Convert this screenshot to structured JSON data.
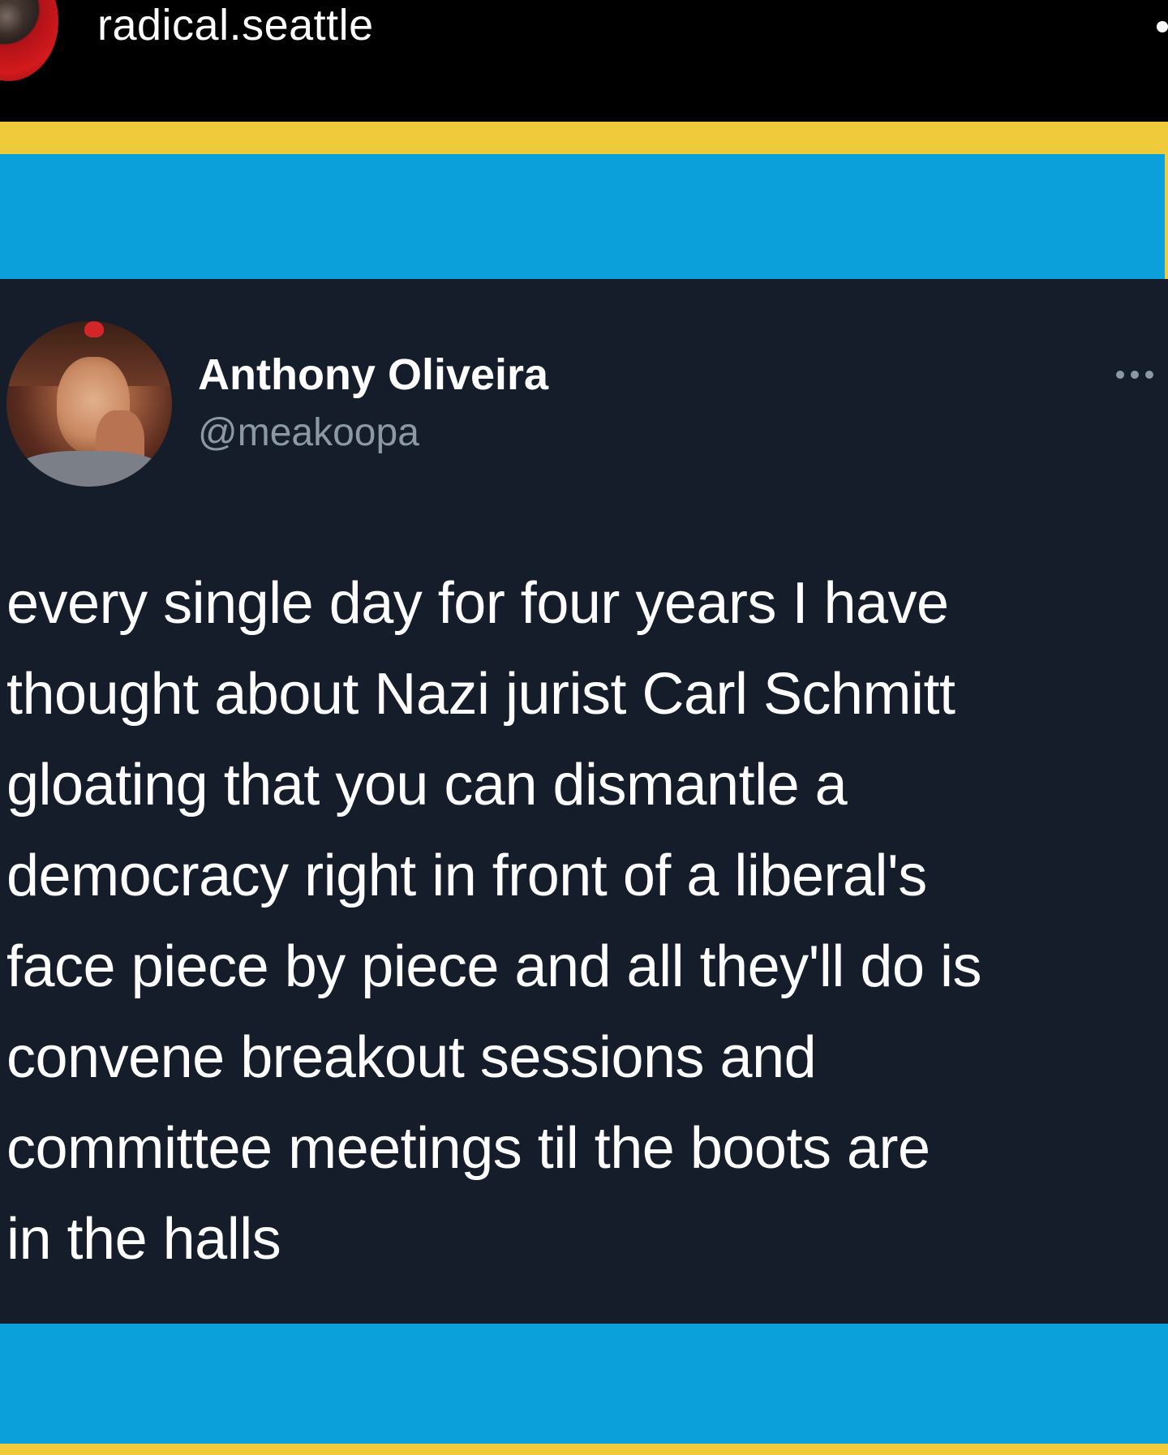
{
  "post": {
    "username": "radical.seattle"
  },
  "tweet": {
    "name": "Anthony Oliveira",
    "handle": "@meakoopa",
    "text": "every single day for four years I have\nthought about Nazi jurist Carl Schmitt\ngloating that you can dismantle a\ndemocracy right in front of a liberal's\nface piece by piece and all they'll do is\nconvene breakout sessions and\ncommittee meetings til the boots are\nin the halls"
  },
  "colors": {
    "frame_yellow": "#efcb3c",
    "frame_blue": "#0ba0da",
    "tweet_background": "#151d2a",
    "handle_gray": "#8b98a5"
  },
  "icons": {
    "post_more": "more-dot-icon",
    "tweet_more": "ellipsis-icon"
  }
}
